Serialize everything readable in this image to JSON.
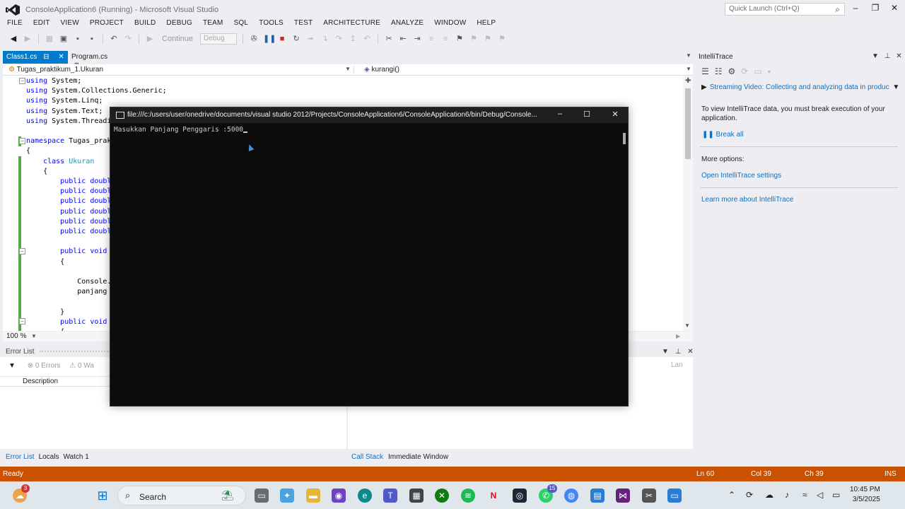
{
  "window": {
    "title": "ConsoleApplication6 (Running) - Microsoft Visual Studio",
    "quick_launch_placeholder": "Quick Launch (Ctrl+Q)",
    "controls": [
      "–",
      "▫",
      "✕"
    ]
  },
  "menu": [
    "FILE",
    "EDIT",
    "VIEW",
    "PROJECT",
    "BUILD",
    "DEBUG",
    "TEAM",
    "SQL",
    "TOOLS",
    "TEST",
    "ARCHITECTURE",
    "ANALYZE",
    "WINDOW",
    "HELP"
  ],
  "toolbar": {
    "continue_label": "Continue",
    "config_value": "Debug"
  },
  "editor": {
    "tabs": [
      {
        "label": "Class1.cs",
        "active": true
      },
      {
        "label": "Program.cs",
        "active": false
      }
    ],
    "nav_left": "Tugas_praktikum_1.Ukuran",
    "nav_right": "kurangi()",
    "code_lines": [
      "using System;",
      "using System.Collections.Generic;",
      "using System.Linq;",
      "using System.Text;",
      "using System.Threadi",
      "",
      "namespace Tugas_prak",
      "{",
      "    class Ukuran",
      "    {",
      "        public doubl",
      "        public doubl",
      "        public doubl",
      "        public doubl",
      "        public doubl",
      "        public doubl",
      "",
      "        public void",
      "        {",
      "",
      "            Console.",
      "            panjang",
      "",
      "        }",
      "        public void",
      "        {"
    ],
    "zoom": "100 %"
  },
  "error_list": {
    "title": "Error List",
    "errors_count": "0 Errors",
    "warnings_count": "0 Wa",
    "description_header": "Description",
    "lan_header": "Lan"
  },
  "bottom_tabs_left": [
    {
      "label": "Error List",
      "active": true
    },
    {
      "label": "Locals",
      "active": false
    },
    {
      "label": "Watch 1",
      "active": false
    }
  ],
  "bottom_tabs_right": [
    {
      "label": "Call Stack",
      "active": true
    },
    {
      "label": "Immediate Window",
      "active": false
    }
  ],
  "intellitrace": {
    "title": "IntelliTrace",
    "video_link": "Streaming Video: Collecting and analyzing data in produc",
    "info": "To view IntelliTrace data, you must break execution of your application.",
    "break_all": "Break all",
    "more_options": "More options:",
    "settings_link": "Open IntelliTrace settings",
    "learn_link": "Learn more about IntelliTrace"
  },
  "console": {
    "title": "file:///c:/users/user/onedrive/documents/visual studio 2012/Projects/ConsoleApplication6/ConsoleApplication6/bin/Debug/Console...",
    "output": "Masukkan Panjang Penggaris :5000"
  },
  "status": {
    "state": "Ready",
    "line": "Ln 60",
    "col": "Col 39",
    "ch": "Ch 39",
    "mode": "INS"
  },
  "taskbar": {
    "search_label": "Search",
    "time": "10:45 PM",
    "date": "3/5/2025",
    "weather_badge": "3",
    "whatsapp_badge": "15"
  },
  "colors": {
    "accent": "#007acc",
    "status_bar": "#ca5100",
    "link": "#0e70c0"
  }
}
